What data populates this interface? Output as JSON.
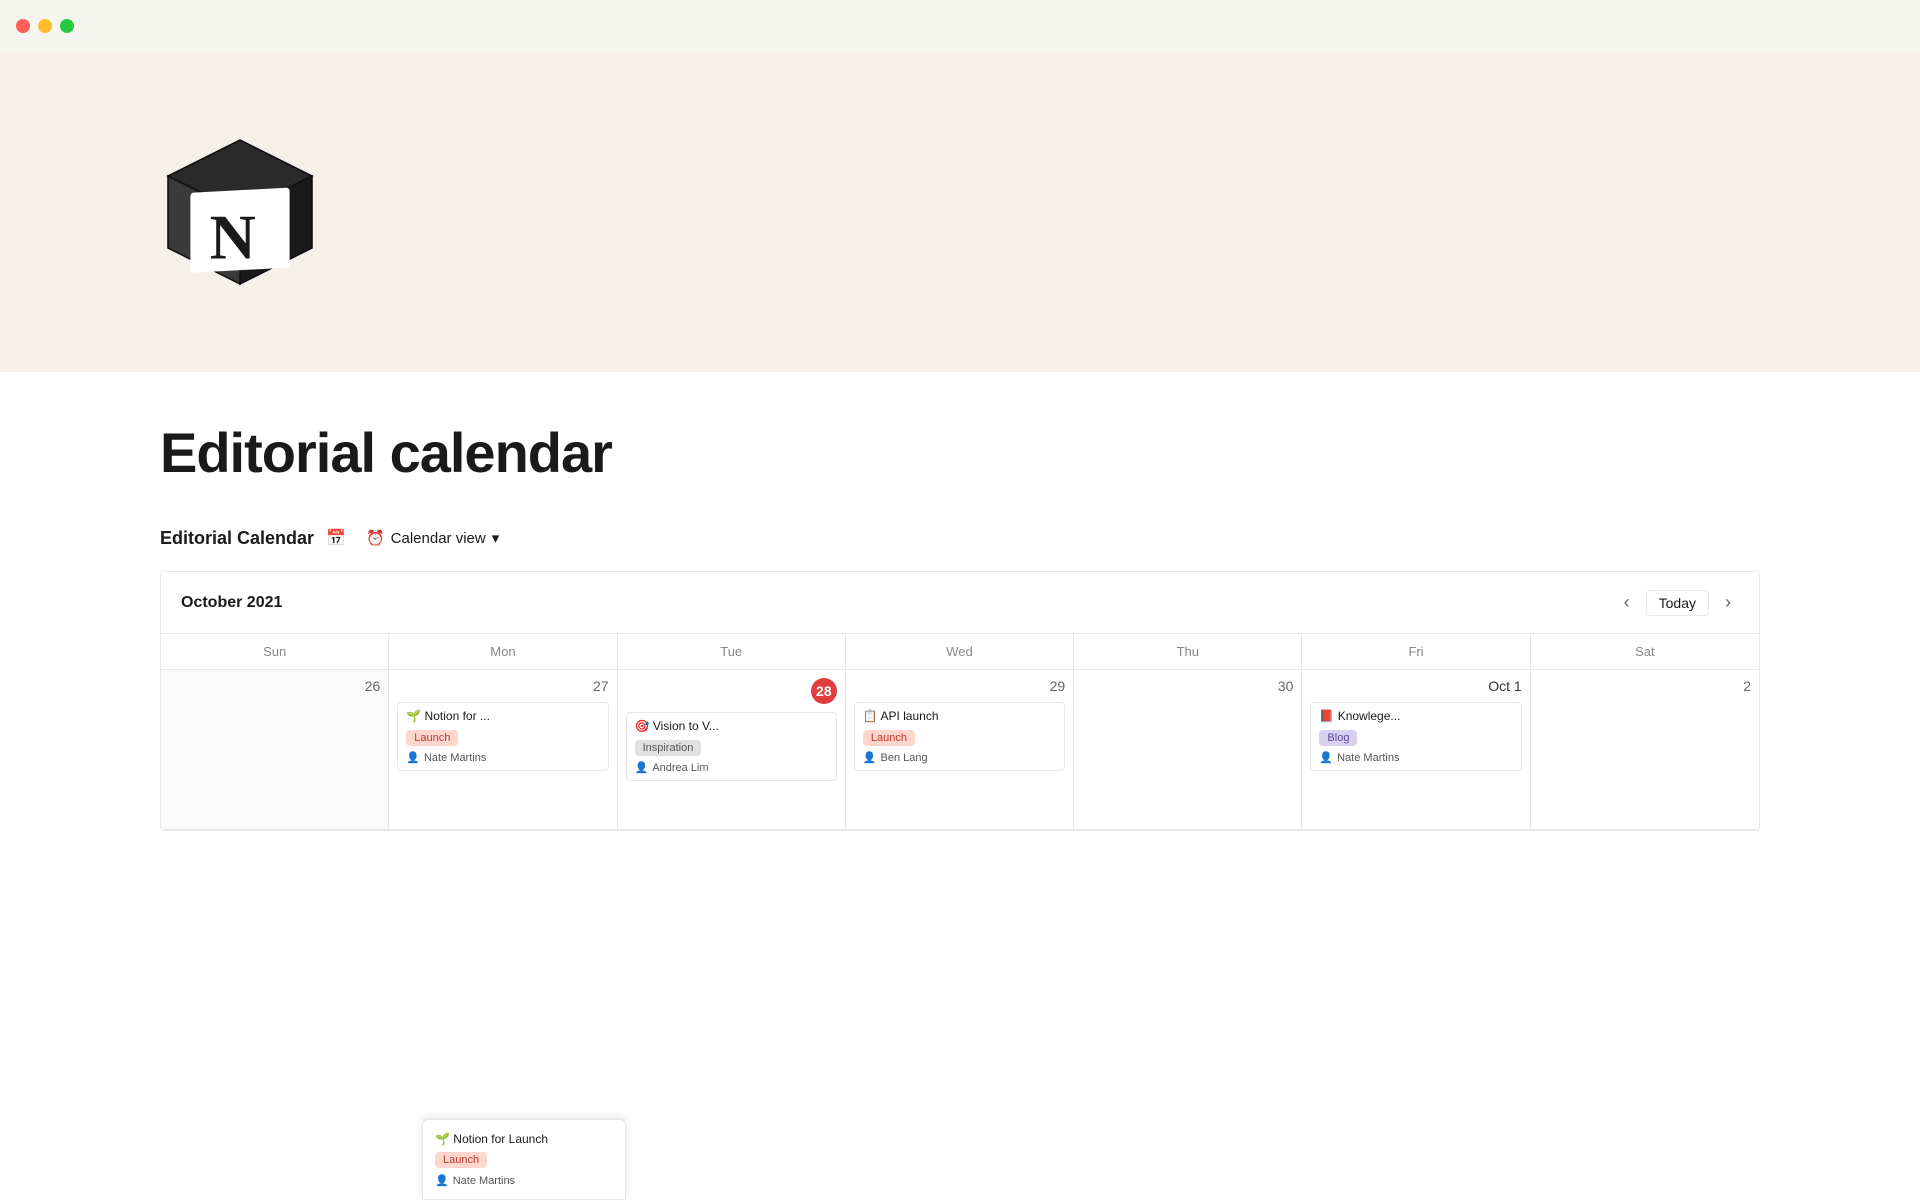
{
  "titlebar": {
    "traffic_lights": [
      "red",
      "yellow",
      "green"
    ]
  },
  "page": {
    "title": "Editorial calendar"
  },
  "database": {
    "name": "Editorial Calendar",
    "view_label": "Calendar view"
  },
  "calendar": {
    "month_year": "October 2021",
    "today_label": "Today",
    "days_of_week": [
      "Sun",
      "Mon",
      "Tue",
      "Wed",
      "Thu",
      "Fri",
      "Sat"
    ],
    "weeks": [
      {
        "days": [
          {
            "num": "26",
            "other_month": true,
            "cards": []
          },
          {
            "num": "27",
            "other_month": false,
            "cards": [
              {
                "emoji": "🌱",
                "title": "Notion for ...",
                "tag": "Launch",
                "tag_class": "tag-launch",
                "person": "Nate Martins"
              }
            ]
          },
          {
            "num": "28",
            "other_month": false,
            "today": true,
            "cards": [
              {
                "emoji": "🎯",
                "title": "Vision to V...",
                "tag": "Inspiration",
                "tag_class": "tag-inspiration",
                "person": "Andrea Lim"
              }
            ]
          },
          {
            "num": "29",
            "other_month": false,
            "cards": [
              {
                "emoji": "📋",
                "title": "API launch",
                "tag": "Launch",
                "tag_class": "tag-launch",
                "person": "Ben Lang"
              }
            ]
          },
          {
            "num": "30",
            "other_month": false,
            "cards": []
          },
          {
            "num": "Oct 1",
            "other_month": false,
            "oct_first": true,
            "cards": [
              {
                "emoji": "📕",
                "title": "Knowlege...",
                "tag": "Blog",
                "tag_class": "tag-blog",
                "person": "Nate Martins"
              }
            ]
          },
          {
            "num": "2",
            "other_month": false,
            "cards": []
          }
        ]
      }
    ]
  },
  "bottom_popup": {
    "emoji": "🌱",
    "title": "Notion for Launch",
    "author": "Nate Martins",
    "tag": "Launch",
    "tag_class": "tag-launch"
  }
}
